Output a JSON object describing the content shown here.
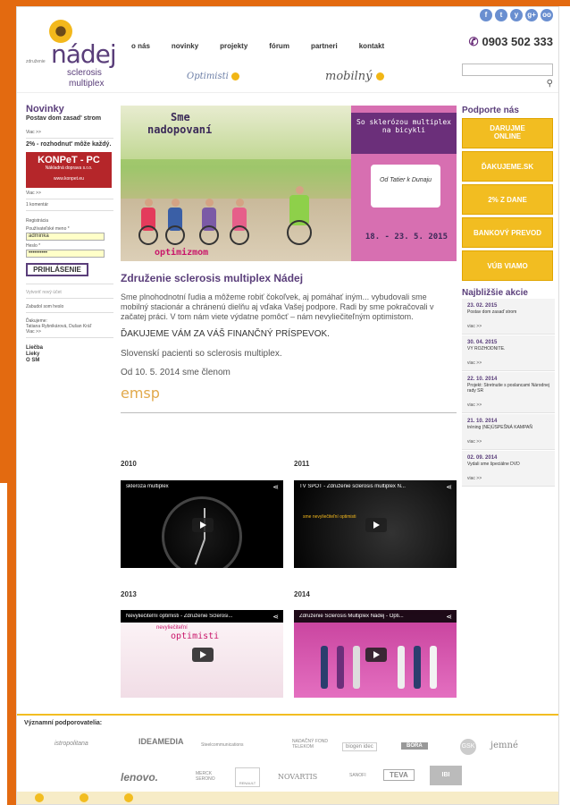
{
  "brand": {
    "small": "združenie",
    "name": "nádej",
    "line1": "sclerosis",
    "line2": "multiplex"
  },
  "nav": [
    "o nás",
    "novinky",
    "projekty",
    "fórum",
    "partneri",
    "kontakt"
  ],
  "subbrands": [
    "Optimisti",
    "mobilný"
  ],
  "social": [
    "f",
    "t",
    "y",
    "g+",
    "oo"
  ],
  "phone": "0903 502 333",
  "left": {
    "news_heading": "Novinky",
    "news1_title": "Postav dom zasad' strom",
    "more": "Viac >>",
    "news2_title": "2% - rozhodnut' môže každý.",
    "konpet_title": "KONPeT - PC",
    "konpet_sub": "Nákladná doprava s.r.o.",
    "konpet_url": "www.konpet.eu",
    "comment": "1 komentár",
    "reg_heading": "Registrácia",
    "username_label": "Používateľské meno *",
    "username_value": "adminka",
    "password_label": "Heslo *",
    "password_value": "••••••••••",
    "login_button": "PRIHLÁSENIE",
    "new_account": "Vytvoriť nový účet",
    "forgot": "Zabudol som heslo",
    "thanks_label": "Ďakujeme:",
    "thanks_names": "Tatiana Rybnikárová, Dušan Kráľ",
    "links": [
      "Liečba",
      "Lieky",
      "O SM"
    ]
  },
  "banner": {
    "line1": "Sme",
    "line2": "nadopovaní",
    "optimism": "optimizmom",
    "purple_text": "So sklerózou multiplex na bicykli",
    "logo_text": "Od Tatier k Dunaju",
    "dates": "18. - 23. 5. 2015"
  },
  "main": {
    "title": "Združenie sclerosis multiplex Nádej",
    "paragraph": "Sme plnohodnotní ľudia a môžeme robiť čokoľvek, aj pomáhať iným... vybudovali sme mobilný stacionár a chránenú dielňu aj vďaka Vašej podpore. Radi by sme pokračovali v začatej práci. V tom nám viete výdatne pomôcť – nám nevyliečiteľným optimistom.",
    "thanks": "ĎAKUJEME VÁM ZA VÁŠ FINANČNÝ PRÍSPEVOK.",
    "patients": "Slovenskí pacienti so sclerosis multiplex.",
    "member": "Od 10. 5. 2014 sme členom",
    "emsp": "emsp"
  },
  "videos": [
    {
      "year": "2010",
      "title": "skleroza multiplex"
    },
    {
      "year": "2011",
      "title": "TV SPOT - Združenie sclerosis multiplex N...",
      "overlay": "sme nevyliečiteľní optimisti"
    },
    {
      "year": "2013",
      "title": "Nevyliečiteľní optimisti - Združenie Sclerosi...",
      "overlay": "nevyliečiteľní",
      "overlay2": "optimisti"
    },
    {
      "year": "2014",
      "title": "Združenie Sclerosis Multiplex Nádej - Opti..."
    }
  ],
  "right": {
    "support_heading": "Podporte nás",
    "buttons": [
      "DARUJME ONLINE",
      "ĎAKUJEME.SK",
      "2% Z DANE",
      "BANKOVÝ PREVOD",
      "VÚB VIAMO"
    ],
    "events_heading": "Najbližšie akcie",
    "events": [
      {
        "date": "23. 02. 2015",
        "text": "Postav dom zasaď strom",
        "more": "viac >>"
      },
      {
        "date": "30. 04. 2015",
        "text": "VY ROZHODNITE.",
        "more": "viac >>"
      },
      {
        "date": "22. 10. 2014",
        "text": "Projekt: Stretnutie s poslancami Národnej rady SR",
        "more": "viac >>"
      },
      {
        "date": "21. 10. 2014",
        "text": "tréning (NE)ÚSPEŠNÁ KAMPAŇ",
        "more": "viac >>"
      },
      {
        "date": "02. 09. 2014",
        "text": "Vydali sme špeciálne DVD",
        "more": "viac >>"
      }
    ]
  },
  "sponsors_heading": "Významní podporovatelia:",
  "sponsors_row1": [
    "istropolitana",
    "IDEAMEDIA",
    "Steelcommunications",
    "NADAČNÝ FOND TELEKOM",
    "biogen idec",
    "BORA",
    "GSK",
    "jemné"
  ],
  "sponsors_row2": [
    "lenovo.",
    "MERCK SERONO",
    "RENAULT",
    "NOVARTIS",
    "SANOFI",
    "TEVA",
    "IBI"
  ]
}
